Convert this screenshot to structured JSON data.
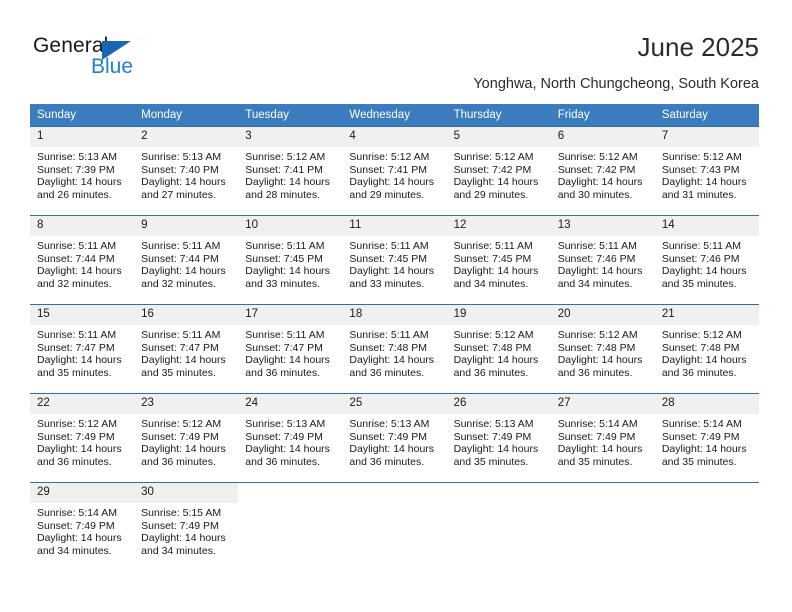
{
  "brand": {
    "name_top": "General",
    "name_bottom": "Blue",
    "triangle_color": "#1668b3",
    "blue_text_color": "#1f7fd0"
  },
  "header": {
    "title": "June 2025",
    "subtitle": "Yonghwa, North Chungcheong, South Korea",
    "header_bg_color": "#3a7cbe",
    "row_border_color": "#2f6fae",
    "daynum_bg_color": "#f0f0f0"
  },
  "weekdays": [
    "Sunday",
    "Monday",
    "Tuesday",
    "Wednesday",
    "Thursday",
    "Friday",
    "Saturday"
  ],
  "weeks": [
    [
      {
        "day": "1",
        "sunrise": "Sunrise: 5:13 AM",
        "sunset": "Sunset: 7:39 PM",
        "daylight1": "Daylight: 14 hours",
        "daylight2": "and 26 minutes."
      },
      {
        "day": "2",
        "sunrise": "Sunrise: 5:13 AM",
        "sunset": "Sunset: 7:40 PM",
        "daylight1": "Daylight: 14 hours",
        "daylight2": "and 27 minutes."
      },
      {
        "day": "3",
        "sunrise": "Sunrise: 5:12 AM",
        "sunset": "Sunset: 7:41 PM",
        "daylight1": "Daylight: 14 hours",
        "daylight2": "and 28 minutes."
      },
      {
        "day": "4",
        "sunrise": "Sunrise: 5:12 AM",
        "sunset": "Sunset: 7:41 PM",
        "daylight1": "Daylight: 14 hours",
        "daylight2": "and 29 minutes."
      },
      {
        "day": "5",
        "sunrise": "Sunrise: 5:12 AM",
        "sunset": "Sunset: 7:42 PM",
        "daylight1": "Daylight: 14 hours",
        "daylight2": "and 29 minutes."
      },
      {
        "day": "6",
        "sunrise": "Sunrise: 5:12 AM",
        "sunset": "Sunset: 7:42 PM",
        "daylight1": "Daylight: 14 hours",
        "daylight2": "and 30 minutes."
      },
      {
        "day": "7",
        "sunrise": "Sunrise: 5:12 AM",
        "sunset": "Sunset: 7:43 PM",
        "daylight1": "Daylight: 14 hours",
        "daylight2": "and 31 minutes."
      }
    ],
    [
      {
        "day": "8",
        "sunrise": "Sunrise: 5:11 AM",
        "sunset": "Sunset: 7:44 PM",
        "daylight1": "Daylight: 14 hours",
        "daylight2": "and 32 minutes."
      },
      {
        "day": "9",
        "sunrise": "Sunrise: 5:11 AM",
        "sunset": "Sunset: 7:44 PM",
        "daylight1": "Daylight: 14 hours",
        "daylight2": "and 32 minutes."
      },
      {
        "day": "10",
        "sunrise": "Sunrise: 5:11 AM",
        "sunset": "Sunset: 7:45 PM",
        "daylight1": "Daylight: 14 hours",
        "daylight2": "and 33 minutes."
      },
      {
        "day": "11",
        "sunrise": "Sunrise: 5:11 AM",
        "sunset": "Sunset: 7:45 PM",
        "daylight1": "Daylight: 14 hours",
        "daylight2": "and 33 minutes."
      },
      {
        "day": "12",
        "sunrise": "Sunrise: 5:11 AM",
        "sunset": "Sunset: 7:45 PM",
        "daylight1": "Daylight: 14 hours",
        "daylight2": "and 34 minutes."
      },
      {
        "day": "13",
        "sunrise": "Sunrise: 5:11 AM",
        "sunset": "Sunset: 7:46 PM",
        "daylight1": "Daylight: 14 hours",
        "daylight2": "and 34 minutes."
      },
      {
        "day": "14",
        "sunrise": "Sunrise: 5:11 AM",
        "sunset": "Sunset: 7:46 PM",
        "daylight1": "Daylight: 14 hours",
        "daylight2": "and 35 minutes."
      }
    ],
    [
      {
        "day": "15",
        "sunrise": "Sunrise: 5:11 AM",
        "sunset": "Sunset: 7:47 PM",
        "daylight1": "Daylight: 14 hours",
        "daylight2": "and 35 minutes."
      },
      {
        "day": "16",
        "sunrise": "Sunrise: 5:11 AM",
        "sunset": "Sunset: 7:47 PM",
        "daylight1": "Daylight: 14 hours",
        "daylight2": "and 35 minutes."
      },
      {
        "day": "17",
        "sunrise": "Sunrise: 5:11 AM",
        "sunset": "Sunset: 7:47 PM",
        "daylight1": "Daylight: 14 hours",
        "daylight2": "and 36 minutes."
      },
      {
        "day": "18",
        "sunrise": "Sunrise: 5:11 AM",
        "sunset": "Sunset: 7:48 PM",
        "daylight1": "Daylight: 14 hours",
        "daylight2": "and 36 minutes."
      },
      {
        "day": "19",
        "sunrise": "Sunrise: 5:12 AM",
        "sunset": "Sunset: 7:48 PM",
        "daylight1": "Daylight: 14 hours",
        "daylight2": "and 36 minutes."
      },
      {
        "day": "20",
        "sunrise": "Sunrise: 5:12 AM",
        "sunset": "Sunset: 7:48 PM",
        "daylight1": "Daylight: 14 hours",
        "daylight2": "and 36 minutes."
      },
      {
        "day": "21",
        "sunrise": "Sunrise: 5:12 AM",
        "sunset": "Sunset: 7:48 PM",
        "daylight1": "Daylight: 14 hours",
        "daylight2": "and 36 minutes."
      }
    ],
    [
      {
        "day": "22",
        "sunrise": "Sunrise: 5:12 AM",
        "sunset": "Sunset: 7:49 PM",
        "daylight1": "Daylight: 14 hours",
        "daylight2": "and 36 minutes."
      },
      {
        "day": "23",
        "sunrise": "Sunrise: 5:12 AM",
        "sunset": "Sunset: 7:49 PM",
        "daylight1": "Daylight: 14 hours",
        "daylight2": "and 36 minutes."
      },
      {
        "day": "24",
        "sunrise": "Sunrise: 5:13 AM",
        "sunset": "Sunset: 7:49 PM",
        "daylight1": "Daylight: 14 hours",
        "daylight2": "and 36 minutes."
      },
      {
        "day": "25",
        "sunrise": "Sunrise: 5:13 AM",
        "sunset": "Sunset: 7:49 PM",
        "daylight1": "Daylight: 14 hours",
        "daylight2": "and 36 minutes."
      },
      {
        "day": "26",
        "sunrise": "Sunrise: 5:13 AM",
        "sunset": "Sunset: 7:49 PM",
        "daylight1": "Daylight: 14 hours",
        "daylight2": "and 35 minutes."
      },
      {
        "day": "27",
        "sunrise": "Sunrise: 5:14 AM",
        "sunset": "Sunset: 7:49 PM",
        "daylight1": "Daylight: 14 hours",
        "daylight2": "and 35 minutes."
      },
      {
        "day": "28",
        "sunrise": "Sunrise: 5:14 AM",
        "sunset": "Sunset: 7:49 PM",
        "daylight1": "Daylight: 14 hours",
        "daylight2": "and 35 minutes."
      }
    ],
    [
      {
        "day": "29",
        "sunrise": "Sunrise: 5:14 AM",
        "sunset": "Sunset: 7:49 PM",
        "daylight1": "Daylight: 14 hours",
        "daylight2": "and 34 minutes."
      },
      {
        "day": "30",
        "sunrise": "Sunrise: 5:15 AM",
        "sunset": "Sunset: 7:49 PM",
        "daylight1": "Daylight: 14 hours",
        "daylight2": "and 34 minutes."
      },
      {
        "day": "",
        "sunrise": "",
        "sunset": "",
        "daylight1": "",
        "daylight2": ""
      },
      {
        "day": "",
        "sunrise": "",
        "sunset": "",
        "daylight1": "",
        "daylight2": ""
      },
      {
        "day": "",
        "sunrise": "",
        "sunset": "",
        "daylight1": "",
        "daylight2": ""
      },
      {
        "day": "",
        "sunrise": "",
        "sunset": "",
        "daylight1": "",
        "daylight2": ""
      },
      {
        "day": "",
        "sunrise": "",
        "sunset": "",
        "daylight1": "",
        "daylight2": ""
      }
    ]
  ]
}
